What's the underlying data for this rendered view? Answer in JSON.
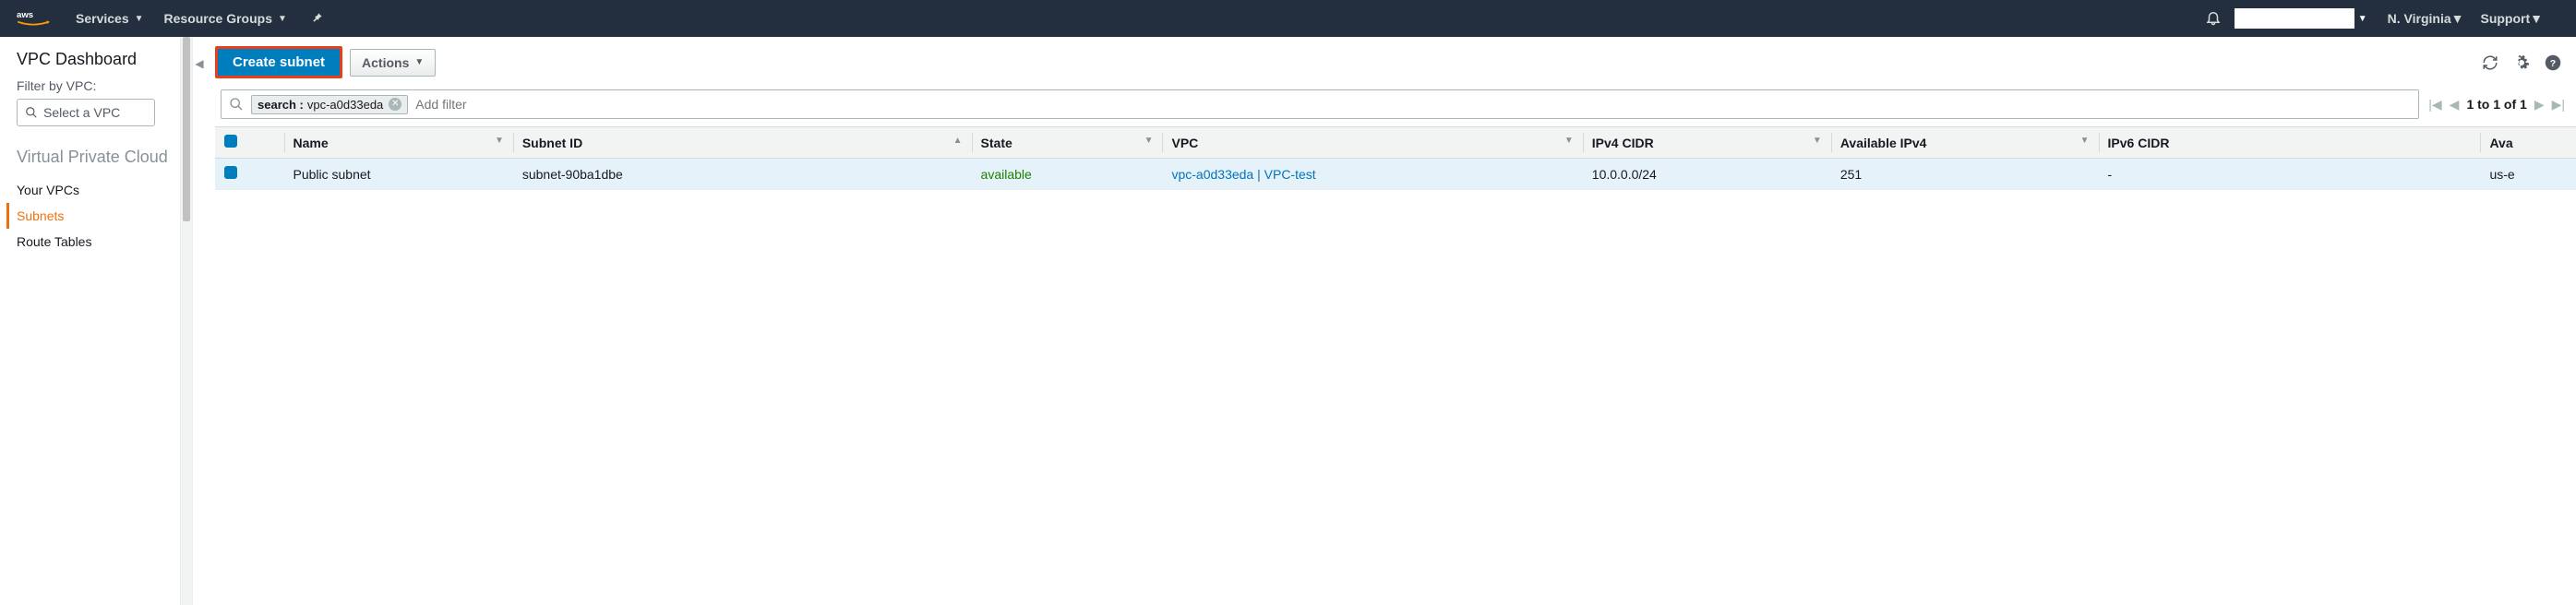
{
  "topnav": {
    "services": "Services",
    "resource_groups": "Resource Groups",
    "region": "N. Virginia",
    "support": "Support"
  },
  "sidebar": {
    "dashboard": "VPC Dashboard",
    "filter_label": "Filter by VPC:",
    "select_placeholder": "Select a VPC",
    "section_title": "Virtual Private Cloud",
    "links": {
      "your_vpcs": "Your VPCs",
      "subnets": "Subnets",
      "route_tables": "Route Tables"
    }
  },
  "toolbar": {
    "create_label": "Create subnet",
    "actions_label": "Actions"
  },
  "search": {
    "tag_key": "search",
    "tag_value": "vpc-a0d33eda",
    "placeholder": "Add filter"
  },
  "pager": {
    "text": "1 to 1 of 1"
  },
  "columns": {
    "name": "Name",
    "subnet_id": "Subnet ID",
    "state": "State",
    "vpc": "VPC",
    "ipv4_cidr": "IPv4 CIDR",
    "available_ipv4": "Available IPv4",
    "ipv6_cidr": "IPv6 CIDR",
    "az": "Ava"
  },
  "rows": [
    {
      "name": "Public subnet",
      "subnet_id": "subnet-90ba1dbe",
      "state": "available",
      "vpc": "vpc-a0d33eda | VPC-test",
      "ipv4_cidr": "10.0.0.0/24",
      "available_ipv4": "251",
      "ipv6_cidr": "-",
      "az": "us-e"
    }
  ]
}
